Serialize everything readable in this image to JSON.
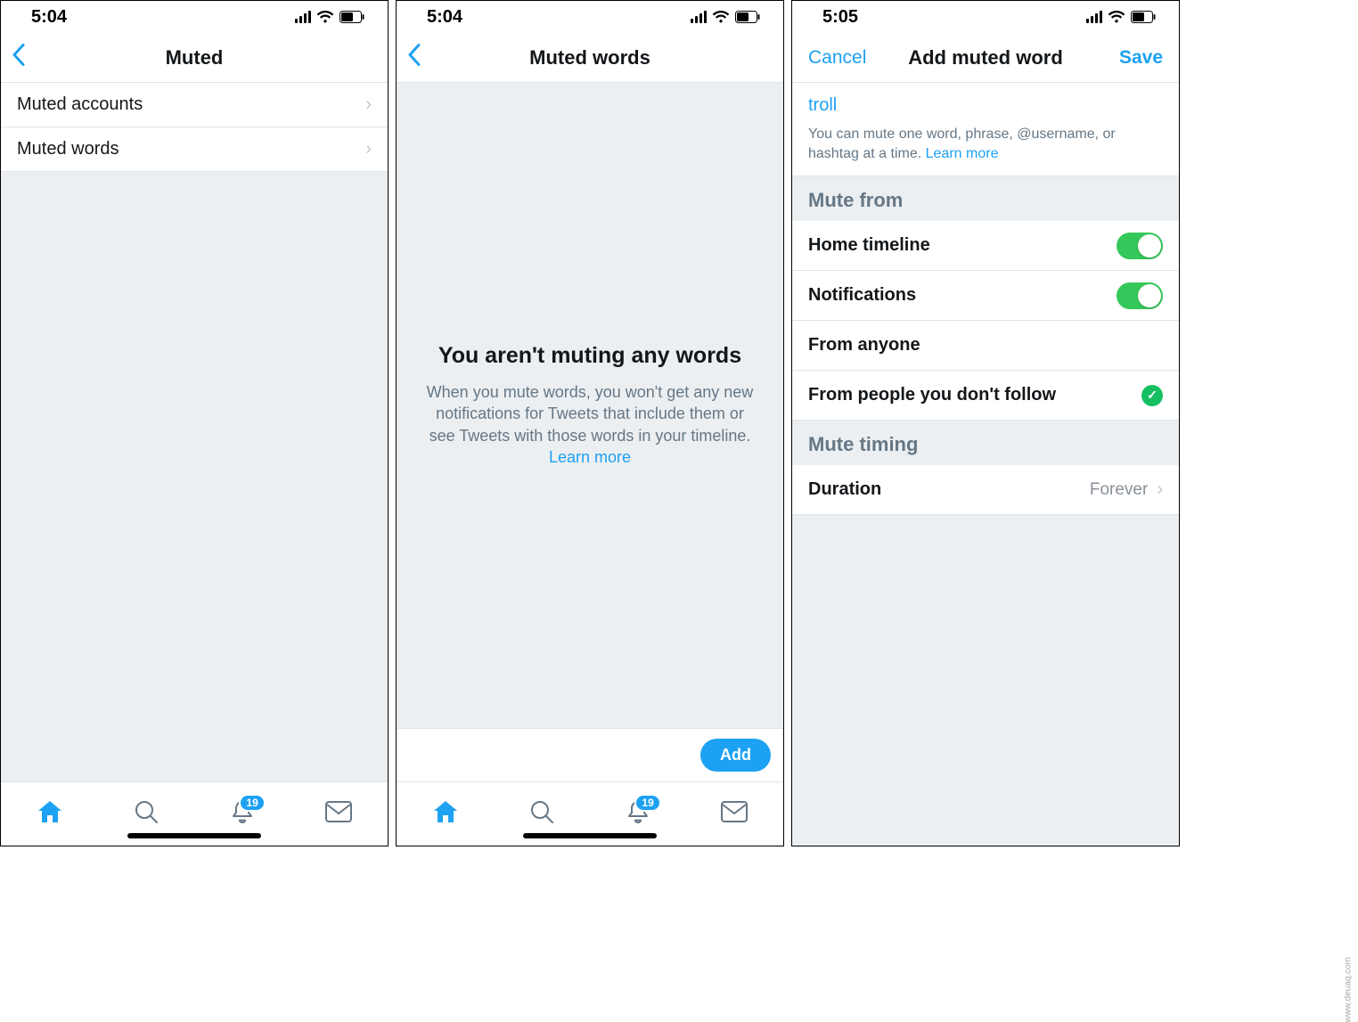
{
  "status_bar": {
    "time_a": "5:04",
    "time_b": "5:04",
    "time_c": "5:05"
  },
  "screen1": {
    "title": "Muted",
    "rows": [
      {
        "label": "Muted accounts"
      },
      {
        "label": "Muted words"
      }
    ]
  },
  "screen2": {
    "title": "Muted words",
    "empty_title": "You aren't muting any words",
    "empty_desc": "When you mute words, you won't get any new notifications for Tweets that include them or see Tweets with those words in your timeline.",
    "learn_more": "Learn more",
    "add_label": "Add"
  },
  "screen3": {
    "cancel": "Cancel",
    "title": "Add muted word",
    "save": "Save",
    "word": "troll",
    "helper": "You can mute one word, phrase, @username, or hashtag at a time.",
    "learn_more": "Learn more",
    "section_mute_from": "Mute from",
    "row_home": "Home timeline",
    "row_notifications": "Notifications",
    "row_anyone": "From anyone",
    "row_dont_follow": "From people you don't follow",
    "section_timing": "Mute timing",
    "row_duration": "Duration",
    "duration_value": "Forever"
  },
  "tabs": {
    "badge_count": "19"
  },
  "watermark": "www.deuaq.com"
}
